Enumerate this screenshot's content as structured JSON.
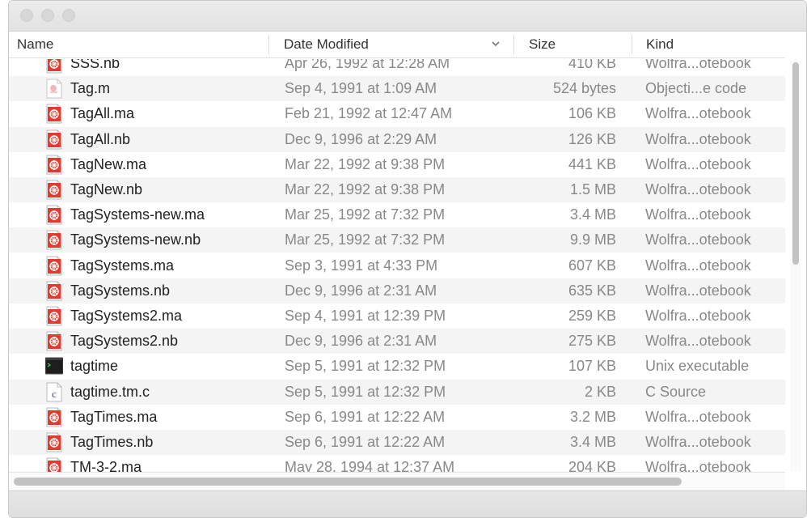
{
  "columns": {
    "name": "Name",
    "date": "Date Modified",
    "size": "Size",
    "kind": "Kind"
  },
  "sort_indicator_icon": "chevron-down-icon",
  "rows": [
    {
      "name": "SSS.nb",
      "date": "Apr 26, 1992 at 12:28 AM",
      "size": "410 KB",
      "kind": "Wolfra...otebook",
      "icon": "mathematica-notebook-icon"
    },
    {
      "name": "Tag.m",
      "date": "Sep 4, 1991 at 1:09 AM",
      "size": "524 bytes",
      "kind": "Objecti...e code",
      "icon": "objective-c-file-icon"
    },
    {
      "name": "TagAll.ma",
      "date": "Feb 21, 1992 at 12:47 AM",
      "size": "106 KB",
      "kind": "Wolfra...otebook",
      "icon": "mathematica-notebook-icon"
    },
    {
      "name": "TagAll.nb",
      "date": "Dec 9, 1996 at 2:29 AM",
      "size": "126 KB",
      "kind": "Wolfra...otebook",
      "icon": "mathematica-notebook-icon"
    },
    {
      "name": "TagNew.ma",
      "date": "Mar 22, 1992 at 9:38 PM",
      "size": "441 KB",
      "kind": "Wolfra...otebook",
      "icon": "mathematica-notebook-icon"
    },
    {
      "name": "TagNew.nb",
      "date": "Mar 22, 1992 at 9:38 PM",
      "size": "1.5 MB",
      "kind": "Wolfra...otebook",
      "icon": "mathematica-notebook-icon"
    },
    {
      "name": "TagSystems-new.ma",
      "date": "Mar 25, 1992 at 7:32 PM",
      "size": "3.4 MB",
      "kind": "Wolfra...otebook",
      "icon": "mathematica-notebook-icon"
    },
    {
      "name": "TagSystems-new.nb",
      "date": "Mar 25, 1992 at 7:32 PM",
      "size": "9.9 MB",
      "kind": "Wolfra...otebook",
      "icon": "mathematica-notebook-icon"
    },
    {
      "name": "TagSystems.ma",
      "date": "Sep 3, 1991 at 4:33 PM",
      "size": "607 KB",
      "kind": "Wolfra...otebook",
      "icon": "mathematica-notebook-icon"
    },
    {
      "name": "TagSystems.nb",
      "date": "Dec 9, 1996 at 2:31 AM",
      "size": "635 KB",
      "kind": "Wolfra...otebook",
      "icon": "mathematica-notebook-icon"
    },
    {
      "name": "TagSystems2.ma",
      "date": "Sep 4, 1991 at 12:39 PM",
      "size": "259 KB",
      "kind": "Wolfra...otebook",
      "icon": "mathematica-notebook-icon"
    },
    {
      "name": "TagSystems2.nb",
      "date": "Dec 9, 1996 at 2:31 AM",
      "size": "275 KB",
      "kind": "Wolfra...otebook",
      "icon": "mathematica-notebook-icon"
    },
    {
      "name": "tagtime",
      "date": "Sep 5, 1991 at 12:32 PM",
      "size": "107 KB",
      "kind": "Unix executable",
      "icon": "terminal-executable-icon"
    },
    {
      "name": "tagtime.tm.c",
      "date": "Sep 5, 1991 at 12:32 PM",
      "size": "2 KB",
      "kind": "C Source",
      "icon": "c-source-file-icon"
    },
    {
      "name": "TagTimes.ma",
      "date": "Sep 6, 1991 at 12:22 AM",
      "size": "3.2 MB",
      "kind": "Wolfra...otebook",
      "icon": "mathematica-notebook-icon"
    },
    {
      "name": "TagTimes.nb",
      "date": "Sep 6, 1991 at 12:22 AM",
      "size": "3.4 MB",
      "kind": "Wolfra...otebook",
      "icon": "mathematica-notebook-icon"
    },
    {
      "name": "TM-3-2.ma",
      "date": "May 28, 1994 at 12:37 AM",
      "size": "204 KB",
      "kind": "Wolfra...otebook",
      "icon": "mathematica-notebook-icon"
    }
  ]
}
